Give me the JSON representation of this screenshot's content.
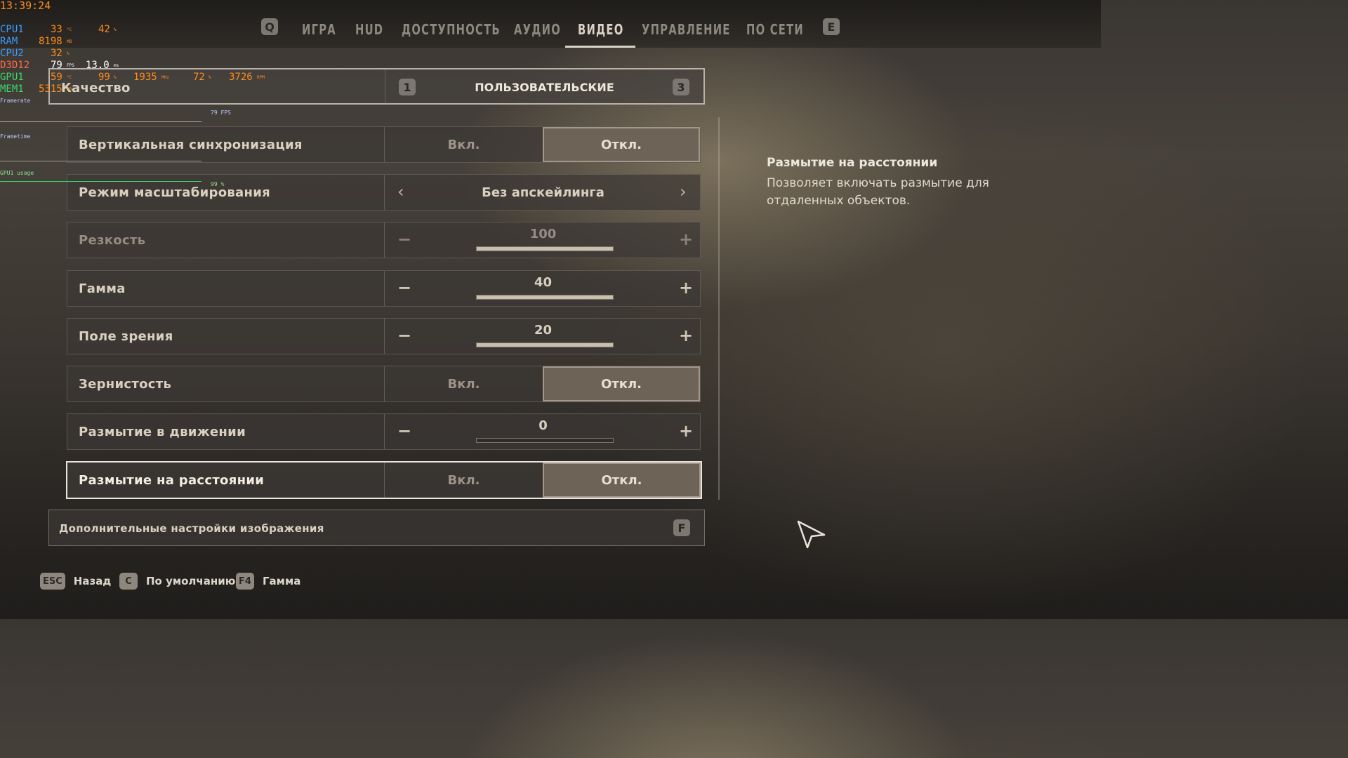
{
  "overlay": {
    "time": "13:39:24",
    "rows": [
      {
        "label": "CPU1",
        "v1": "33",
        "u1": "°C",
        "v2": "42",
        "u2": "%"
      },
      {
        "label": "RAM",
        "v1": "8198",
        "u1": "MB"
      },
      {
        "label": "CPU2",
        "v1": "32",
        "u1": "%"
      },
      {
        "label": "D3D12",
        "v1": "79",
        "u1": "FPS",
        "v2": "13.0",
        "u2": "ms"
      },
      {
        "label": "GPU1",
        "v1": "59",
        "u1": "°C",
        "v2": "99",
        "u2": "%",
        "v3": "1935",
        "u3": "MHz",
        "v4": "72",
        "u4": "%",
        "v5": "3726",
        "u5": "RPM"
      },
      {
        "label": "MEM1",
        "v1": "5315",
        "u1": "MB"
      }
    ],
    "graph_labels": {
      "framerate": "Framerate",
      "frametime": "Frametime",
      "gpu_usage": "GPU1 usage",
      "fps_mark": "79 FPS",
      "gpu_mark": "99 %"
    }
  },
  "tabs": {
    "left_key": "Q",
    "right_key": "E",
    "items": [
      "ИГРА",
      "HUD",
      "ДОСТУПНОСТЬ",
      "АУДИО",
      "ВИДЕО",
      "УПРАВЛЕНИЕ",
      "ПО СЕТИ"
    ],
    "active": "ВИДЕО"
  },
  "quality": {
    "label": "Качество",
    "value": "ПОЛЬЗОВАТЕЛЬСКИЕ",
    "prev_key": "1",
    "next_key": "3"
  },
  "settings": [
    {
      "label": "Вертикальная синхронизация",
      "type": "toggle",
      "on_label": "Вкл.",
      "off_label": "Откл.",
      "value": "off"
    },
    {
      "label": "Режим масштабирования",
      "type": "selector",
      "value": "Без апскейлинга"
    },
    {
      "label": "Резкость",
      "type": "slider",
      "value": "100",
      "fraction": 1.0,
      "disabled": true
    },
    {
      "label": "Гамма",
      "type": "slider",
      "value": "40",
      "fraction": 1.0
    },
    {
      "label": "Поле зрения",
      "type": "slider",
      "value": "20",
      "fraction": 1.0
    },
    {
      "label": "Зернистость",
      "type": "toggle",
      "on_label": "Вкл.",
      "off_label": "Откл.",
      "value": "off"
    },
    {
      "label": "Размытие в движении",
      "type": "slider",
      "value": "0",
      "fraction": 0.0
    },
    {
      "label": "Размытие на расстоянии",
      "type": "toggle",
      "on_label": "Вкл.",
      "off_label": "Откл.",
      "value": "off",
      "selected": true
    }
  ],
  "advanced": {
    "label": "Дополнительные настройки изображения",
    "key": "F"
  },
  "help": {
    "title": "Размытие на расстоянии",
    "body": "Позволяет включать размытие для отдаленных объектов."
  },
  "footer": [
    {
      "key": "ESC",
      "label": "Назад"
    },
    {
      "key": "C",
      "label": "По умолчанию"
    },
    {
      "key": "F4",
      "label": "Гамма"
    }
  ],
  "colors": {
    "accent": "#d9d2c6",
    "selected_option_bg": "#6e6357",
    "overlay_blue": "#3a9cff",
    "overlay_orange": "#ff8c1a"
  }
}
